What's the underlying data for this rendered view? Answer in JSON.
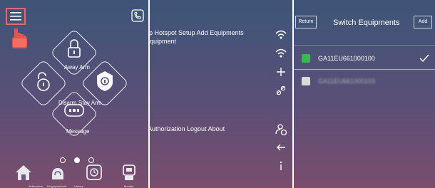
{
  "panel1": {
    "buttons": {
      "away_arm": "Away Arm",
      "disarm": "Disarm",
      "stay_arm": "Stay Arm",
      "message": "Message"
    },
    "bottom_nav": {
      "automation": "Automation",
      "fingerprint_lock": "Fingerprint lock",
      "history": "History",
      "monitor": "Monitor"
    },
    "page_indicator": {
      "count": 3,
      "active_index": 1
    },
    "accent_color": "#e06a73"
  },
  "panel2": {
    "menu_top": "Wifi Setup Hotspot Setup Add Equipments Unbind Equipment",
    "menu_bottom": "Authorization Logout About",
    "side_icons": [
      "wifi-icon",
      "wifi-icon",
      "plus-icon",
      "link-icon",
      "user-clock-icon",
      "arrow-left-icon",
      "info-icon"
    ]
  },
  "panel3": {
    "return_label": "Return",
    "title": "Switch Equipments",
    "add_label": "Add",
    "devices": [
      {
        "name": "GA11EU661000100",
        "status_color": "#2fbf4a",
        "selected": true
      },
      {
        "name": "GA11EU661000103",
        "status_color": "#d9d9de",
        "selected": false,
        "blurred": true
      }
    ]
  }
}
